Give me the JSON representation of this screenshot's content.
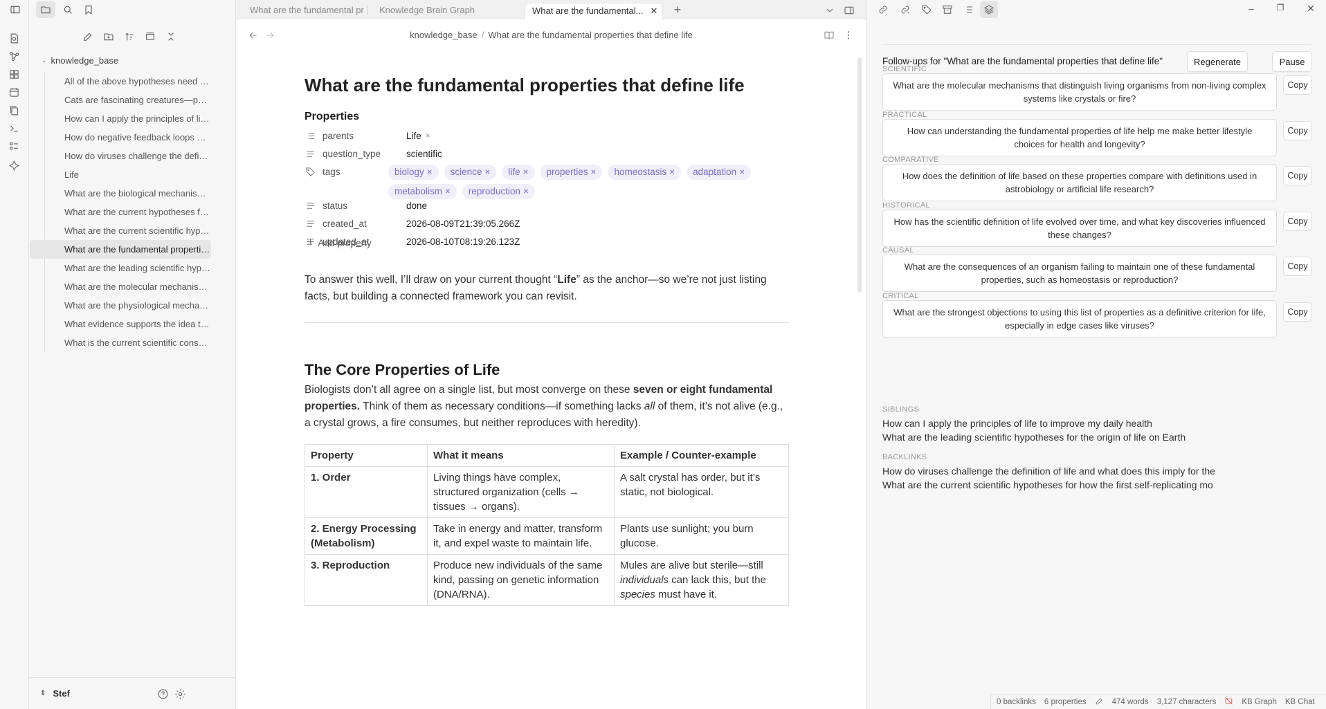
{
  "sidebar": {
    "root": "knowledge_base",
    "files": [
      "All of the above hypotheses need a p...",
      "Cats are fascinating creatures—part c...",
      "How can I apply the principles of life t...",
      "How do negative feedback loops mai...",
      "How do viruses challenge the definiti...",
      "Life",
      "What are the biological mechanisms t...",
      "What are the current hypotheses for t...",
      "What are the current scientific hypoth...",
      "What are the fundamental properties ...",
      "What are the leading scientific hypoth...",
      "What are the molecular mechanisms ...",
      "What are the physiological mechanis...",
      "What evidence supports the idea that...",
      "What is the current scientific consens..."
    ],
    "active_index": 9,
    "vault_name": "Stef"
  },
  "tabs": [
    {
      "label": "What are the fundamental pro..."
    },
    {
      "label": "Knowledge Brain Graph"
    },
    {
      "label": "What are the fundamental...",
      "close": "✕"
    }
  ],
  "breadcrumb": {
    "folder": "knowledge_base",
    "separator": "/",
    "current": "What are the fundamental properties that define life"
  },
  "note": {
    "title": "What are the fundamental properties that define life",
    "properties_heading": "Properties",
    "properties": {
      "parents": {
        "key": "parents",
        "value": "Life"
      },
      "question_type": {
        "key": "question_type",
        "value": "scientific"
      },
      "tags": {
        "key": "tags"
      },
      "status": {
        "key": "status",
        "value": "done"
      },
      "created_at": {
        "key": "created_at",
        "value": "2026-08-09T21:39:05.266Z"
      },
      "updated_at": {
        "key": "updated_at",
        "value": "2026-08-10T08:19:26.123Z"
      }
    },
    "tags": [
      "biology",
      "science",
      "life",
      "properties",
      "homeostasis",
      "adaptation",
      "metabolism",
      "reproduction"
    ],
    "remove_mark": "×",
    "add_property": "Add property",
    "intro": {
      "part1": "To answer this well, I’ll draw on your current thought “",
      "bold": "Life",
      "part2": "” as the anchor—so we’re not just listing facts, but building a connected framework you can revisit."
    },
    "section_heading": "The Core Properties of Life",
    "section_para": {
      "part1": "Biologists don’t all agree on a single list, but most converge on these ",
      "bold": "seven or eight fundamental properties.",
      "part2": " Think of them as necessary conditions—if something lacks ",
      "italic": "all",
      "part3": " of them, it’s not alive (e.g., a crystal grows, a fire consumes, but neither reproduces with heredity)."
    },
    "table": {
      "headers": [
        "Property",
        "What it means",
        "Example / Counter-example"
      ],
      "rows": [
        {
          "property": "1. Order",
          "meaning": "Living things have complex, structured organization (cells → tissues → organs).",
          "example": "A salt crystal has order, but it’s static, not biological."
        },
        {
          "property": "2. Energy Processing (Metabolism)",
          "meaning": "Take in energy and matter, transform it, and expel waste to maintain life.",
          "example": "Plants use sunlight; you burn glucose."
        },
        {
          "property": "3. Reproduction",
          "meaning": "Produce new individuals of the same kind, passing on genetic information (DNA/RNA).",
          "example_part1": "Mules are alive but sterile—still ",
          "example_italic1": "individuals",
          "example_part2": " can lack this, but the ",
          "example_italic2": "species",
          "example_part3": " must have it."
        }
      ]
    }
  },
  "followups": {
    "title": "Follow-ups for \"What are the fundamental properties that define life\"",
    "regenerate": "Regenerate",
    "pause": "Pause",
    "copy_label": "Copy",
    "categories": [
      {
        "label": "SCIENTIFIC",
        "question": "What are the molecular mechanisms that distinguish living organisms from non-living complex systems like crystals or fire?"
      },
      {
        "label": "PRACTICAL",
        "question": "How can understanding the fundamental properties of life help me make better lifestyle choices for health and longevity?"
      },
      {
        "label": "COMPARATIVE",
        "question": "How does the definition of life based on these properties compare with definitions used in astrobiology or artificial life research?"
      },
      {
        "label": "HISTORICAL",
        "question": "How has the scientific definition of life evolved over time, and what key discoveries influenced these changes?"
      },
      {
        "label": "CAUSAL",
        "question": "What are the consequences of an organism failing to maintain one of these fundamental properties, such as homeostasis or reproduction?"
      },
      {
        "label": "CRITICAL",
        "question": "What are the strongest objections to using this list of properties as a definitive criterion for life, especially in edge cases like viruses?"
      }
    ],
    "siblings_label": "SIBLINGS",
    "siblings": [
      "How can I apply the principles of life to improve my daily health",
      "What are the leading scientific hypotheses for the origin of life on Earth"
    ],
    "backlinks_label": "BACKLINKS",
    "backlinks": [
      "How do viruses challenge the definition of life and what does this imply for the",
      "What are the current scientific hypotheses for how the first self-replicating mo"
    ]
  },
  "statusbar": {
    "backlinks": "0 backlinks",
    "properties": "6 properties",
    "words": "474 words",
    "characters": "3,127 characters",
    "kb_graph": "KB Graph",
    "kb_chat": "KB Chat"
  },
  "colors": {
    "tag_bg": "#f0eef9",
    "tag_text": "#7b6cc4",
    "status_red": "#e05252"
  }
}
